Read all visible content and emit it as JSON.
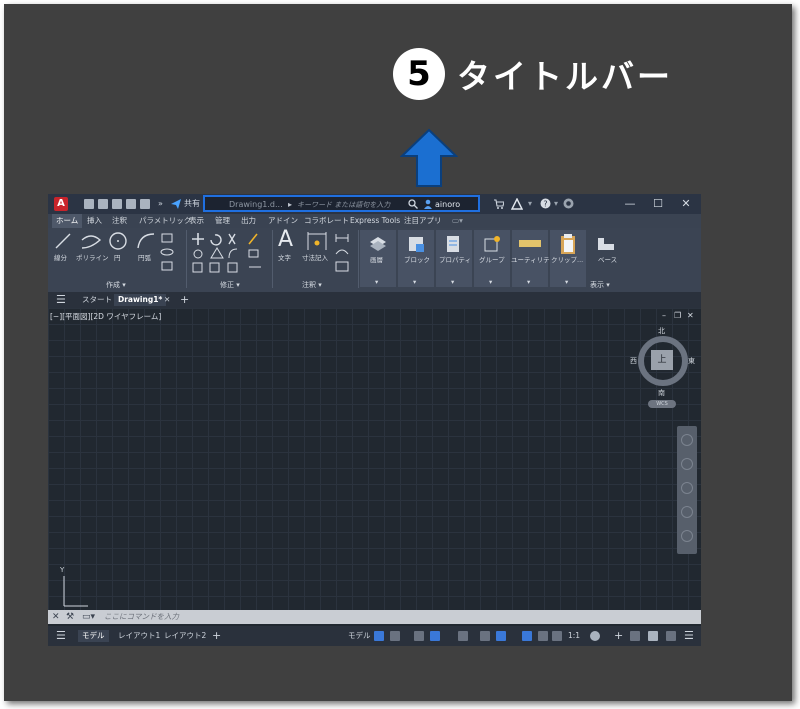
{
  "callout": {
    "number": "5",
    "label": "タイトルバー"
  },
  "colors": {
    "highlight": "#1f6fe0",
    "arrow": "#1b6fd1",
    "logo": "#c8242b"
  },
  "titlebar": {
    "logo": "A",
    "share_label": "共有",
    "file_name": "Drawing1.d...",
    "search_placeholder": "キーワード または語句を入力",
    "user": "ainoro",
    "minimize": "—",
    "maximize": "☐",
    "close": "✕"
  },
  "ribbon_tabs": [
    "ホーム",
    "挿入",
    "注釈",
    "パラメトリック",
    "表示",
    "管理",
    "出力",
    "アドイン",
    "コラボレート",
    "Express Tools",
    "注目アプリ"
  ],
  "ribbon": {
    "draw_tools": [
      "線分",
      "ポリライン",
      "円",
      "円弧"
    ],
    "draw_panel": "作成 ▾",
    "modify_panel": "修正 ▾",
    "annot_tools": [
      "文字",
      "寸法記入"
    ],
    "annot_panel": "注釈 ▾",
    "big_tools": [
      "画層",
      "ブロック",
      "プロパティ",
      "グループ",
      "ユーティリティ",
      "クリップ..."
    ],
    "base_label": "ベース",
    "view_panel": "表示 ▾"
  },
  "file_tabs": {
    "start": "スタート",
    "drawing": "Drawing1*",
    "close": "✕",
    "add": "+"
  },
  "viewport": {
    "label": "[−][平面図][2D ワイヤフレーム]",
    "controls": [
      "–",
      "❐",
      "✕"
    ],
    "viewcube": {
      "top": "上",
      "north": "北",
      "south": "南",
      "east": "東",
      "west": "西"
    },
    "wcs": "WCS"
  },
  "ucs_axis": "Y",
  "command_line": {
    "placeholder": "ここにコマンドを入力"
  },
  "status": {
    "tabs": [
      "モデル",
      "レイアウト1",
      "レイアウト2"
    ],
    "add": "+",
    "model_button": "モデル",
    "scale": "1:1"
  }
}
